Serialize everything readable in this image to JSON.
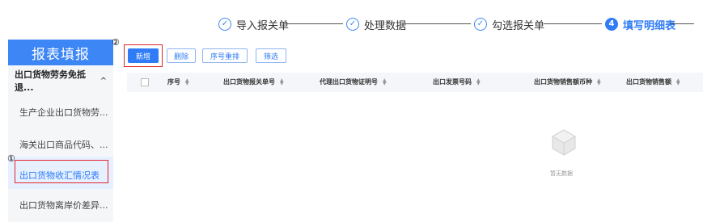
{
  "steps": [
    {
      "label": "导入报关单",
      "icon": "✓"
    },
    {
      "label": "处理数据",
      "icon": "✓"
    },
    {
      "label": "勾选报关单",
      "icon": "✓"
    },
    {
      "label": "填写明细表",
      "icon": "4"
    }
  ],
  "sidebar": {
    "title": "报表填报",
    "group": "出口货物劳务免抵退...",
    "items": [
      "生产企业出口货物劳...",
      "海关出口商品代码、...",
      "出口货物收汇情况表",
      "出口货物离岸价差异..."
    ]
  },
  "toolbar": {
    "add": "新增",
    "delete": "删除",
    "renumber": "序号重排",
    "filter": "筛选"
  },
  "table": {
    "columns": [
      "序号",
      "出口货物报关单号",
      "代理出口货物证明号",
      "出口发票号码",
      "出口货物销售额币种",
      "出口货物销售额"
    ]
  },
  "empty_text": "暂无数据",
  "annotations": [
    "①",
    "②"
  ],
  "colors": {
    "accent": "#2f7cf6",
    "highlight": "#e0262b"
  }
}
